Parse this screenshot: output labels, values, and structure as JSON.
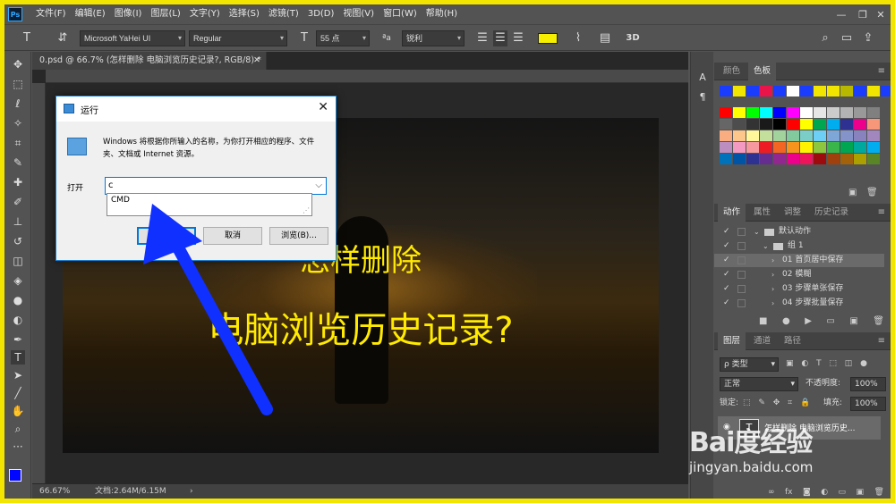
{
  "menubar": {
    "logo": "Ps",
    "items": [
      "文件(F)",
      "编辑(E)",
      "图像(I)",
      "图层(L)",
      "文字(Y)",
      "选择(S)",
      "滤镜(T)",
      "3D(D)",
      "视图(V)",
      "窗口(W)",
      "帮助(H)"
    ]
  },
  "optionsbar": {
    "font_family": "Microsoft YaHei UI",
    "font_style": "Regular",
    "font_size": "55 点",
    "aa_label": "ªa",
    "antialias": "锐利",
    "text_color": "#f6f000"
  },
  "document": {
    "tab_title": "0.psd @ 66.7% (怎样删除 电脑浏览历史记录?, RGB/8) *",
    "canvas_line1": "怎样删除",
    "canvas_line2": "电脑浏览历史记录?",
    "status_zoom": "66.67%",
    "status_doc": "文档:2.64M/6.15M"
  },
  "run_dialog": {
    "title": "运行",
    "description": "Windows 将根据你所输入的名称，为你打开相应的程序、文件夹、文档或 Internet 资源。",
    "open_label": "打开",
    "input_value": "c",
    "suggestion": "CMD",
    "ok_label": "确定",
    "cancel_label": "取消",
    "browse_label": "浏览(B)..."
  },
  "swatches_panel": {
    "tabs": [
      "颜色",
      "色板"
    ],
    "active_tab": "色板",
    "row1": [
      "#1a3cff",
      "#f2e600",
      "#1a3cff",
      "#e8144a",
      "#1a3cff",
      "#ffffff",
      "#1a3cff",
      "#f2e600",
      "#f2e600",
      "#b8b800",
      "#1a3cff",
      "#f2e600",
      "#1a3cff"
    ],
    "grid": [
      [
        "#ff0000",
        "#ffff00",
        "#00ff00",
        "#00ffff",
        "#0000ff",
        "#ff00ff",
        "#ffffff",
        "#e6e6e6",
        "#cccccc",
        "#b3b3b3",
        "#999999",
        "#808080"
      ],
      [
        "#666666",
        "#4d4d4d",
        "#333333",
        "#1a1a1a",
        "#000000",
        "#ff0000",
        "#ffff00",
        "#00a650",
        "#00aeef",
        "#2e3192",
        "#ec008c",
        "#f7977a"
      ],
      [
        "#f9ad81",
        "#fdc68a",
        "#fff79a",
        "#c4df9b",
        "#a2d39c",
        "#82ca9d",
        "#7bcdc8",
        "#6ecff6",
        "#7ea7d8",
        "#8493ca",
        "#8882be",
        "#a187be"
      ],
      [
        "#bc8dbf",
        "#f49ac2",
        "#f6989d",
        "#ed1c24",
        "#f26522",
        "#f7941d",
        "#fff200",
        "#8dc63f",
        "#39b54a",
        "#00a651",
        "#00a99d",
        "#00aeef"
      ],
      [
        "#0072bc",
        "#0054a6",
        "#2e3192",
        "#662d91",
        "#92278f",
        "#ec008c",
        "#ed145b",
        "#9e0b0f",
        "#a0410d",
        "#a36209",
        "#aba000",
        "#598527"
      ]
    ]
  },
  "actions_panel": {
    "tabs": [
      "动作",
      "属性",
      "调整",
      "历史记录"
    ],
    "rows": [
      {
        "label": "默认动作",
        "indent": 0,
        "folder": true,
        "selected": false
      },
      {
        "label": "组 1",
        "indent": 1,
        "folder": true,
        "selected": false
      },
      {
        "label": "01 首页居中保存",
        "indent": 2,
        "folder": false,
        "selected": true
      },
      {
        "label": "02 模糊",
        "indent": 2,
        "folder": false,
        "selected": false
      },
      {
        "label": "03 步骤单张保存",
        "indent": 2,
        "folder": false,
        "selected": false
      },
      {
        "label": "04 步骤批量保存",
        "indent": 2,
        "folder": false,
        "selected": false
      }
    ]
  },
  "layers_panel": {
    "tabs": [
      "图层",
      "通道",
      "路径"
    ],
    "filter": "ρ 类型",
    "blend_mode": "正常",
    "opacity_label": "不透明度:",
    "opacity_value": "100%",
    "lock_label": "锁定:",
    "fill_label": "填充:",
    "fill_value": "100%",
    "layer_name": "怎样删除 电脑浏览历史...",
    "layer_thumb": "T"
  },
  "watermark": {
    "logo": "Bai度经验",
    "url": "jingyan.baidu.com"
  }
}
